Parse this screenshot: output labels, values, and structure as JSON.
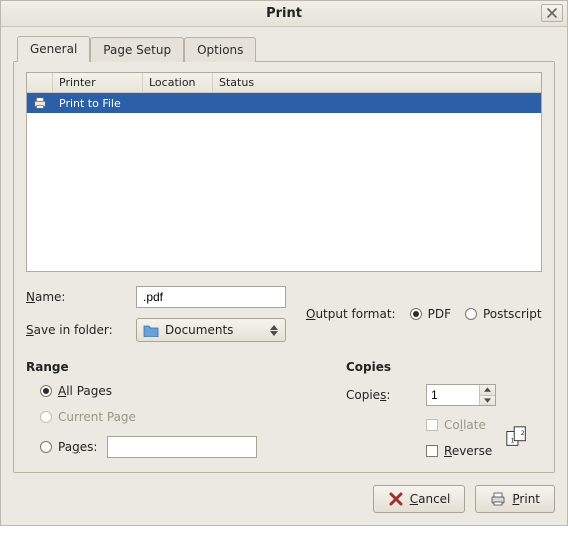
{
  "window": {
    "title": "Print"
  },
  "tabs": [
    {
      "label": "General"
    },
    {
      "label": "Page Setup"
    },
    {
      "label": "Options"
    }
  ],
  "printer_list": {
    "columns": {
      "printer": "Printer",
      "location": "Location",
      "status": "Status"
    },
    "rows": [
      {
        "name": "Print to File",
        "location": "",
        "status": "",
        "selected": true
      }
    ]
  },
  "file": {
    "name_label_pre": "",
    "name_label_u": "N",
    "name_label_post": "ame:",
    "name_value": ".pdf",
    "folder_label_pre": "",
    "folder_label_u": "S",
    "folder_label_post": "ave in folder:",
    "folder_value": "Documents",
    "output_label_pre": "",
    "output_label_u": "O",
    "output_label_post": "utput format:",
    "pdf_label": "PDF",
    "ps_label": "Postscript"
  },
  "range": {
    "title": "Range",
    "all_pre": "",
    "all_u": "A",
    "all_post": "ll Pages",
    "current_label": "Current Page",
    "pages_pre": "Pa",
    "pages_u": "g",
    "pages_post": "es:",
    "pages_value": ""
  },
  "copies": {
    "title": "Copies",
    "copies_label_pre": "Copie",
    "copies_label_u": "s",
    "copies_label_post": ":",
    "copies_value": "1",
    "collate_pre": "Co",
    "collate_u": "l",
    "collate_post": "late",
    "reverse_pre": "",
    "reverse_u": "R",
    "reverse_post": "everse"
  },
  "buttons": {
    "cancel_pre": "",
    "cancel_u": "C",
    "cancel_post": "ancel",
    "print_pre": "",
    "print_u": "P",
    "print_post": "rint"
  }
}
